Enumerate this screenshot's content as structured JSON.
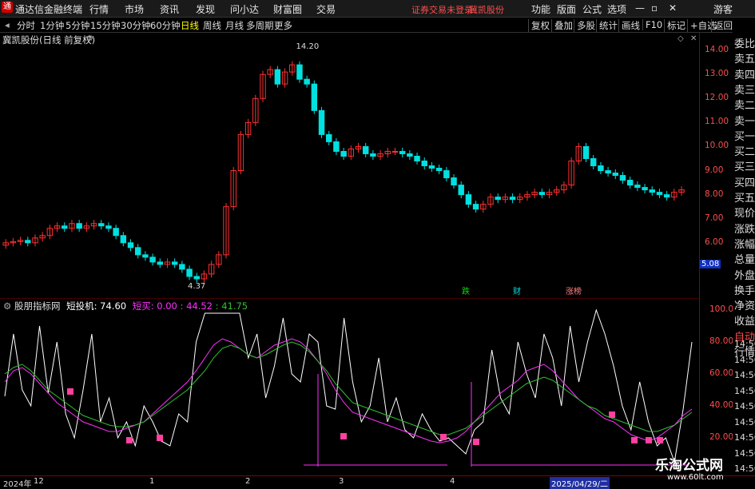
{
  "menu": {
    "app_name": "通达信金融终端",
    "items": [
      "行情",
      "市场",
      "资讯",
      "发现",
      "问小达",
      "财富圈",
      "交易"
    ],
    "notice": "证券交易未登录",
    "stock_link": "冀凯股份",
    "right_items": [
      "功能",
      "版面",
      "公式",
      "选项"
    ],
    "guest": "游客"
  },
  "toolbar": {
    "periods": [
      "分时",
      "1分钟",
      "5分钟",
      "15分钟",
      "30分钟",
      "60分钟",
      "日线",
      "周线",
      "月线",
      "多周期",
      "更多"
    ],
    "active_period": "日线",
    "buttons": [
      "复权",
      "叠加",
      "多股",
      "统计",
      "画线",
      "F10",
      "标记",
      "+自选",
      "返回"
    ]
  },
  "chart_title": "冀凯股份(日线 前复权)",
  "price_labels": {
    "high": "14.20",
    "low": "4.37",
    "current": "5.08"
  },
  "event_tags": [
    "跌",
    "财",
    "涨榜"
  ],
  "indicator": {
    "name": "股朋指标网",
    "line1_label": "短投机: 74.60",
    "line2_label": "短买: 0.00",
    "v1": "44.52",
    "v2": "41.75"
  },
  "right_panel": [
    "委比",
    "卖五",
    "卖四",
    "卖三",
    "卖二",
    "卖一",
    "买一",
    "买二",
    "买三",
    "买四",
    "买五",
    "现价",
    "涨跌",
    "涨幅",
    "总量",
    "外盘",
    "换手",
    "净资",
    "收益",
    "自动",
    "行情"
  ],
  "time_col": [
    "14:56",
    "14:56",
    "14:56",
    "14:56",
    "14:56",
    "14:56",
    "14:56",
    "14:56",
    "14:56"
  ],
  "dates": {
    "year": "2024年",
    "m12": "12",
    "m1": "1",
    "m2": "2",
    "m3": "3",
    "m4": "4",
    "cursor": "2025/04/29/二"
  },
  "watermark": {
    "cn": "乐淘公式网",
    "url": "www.60lt.com"
  },
  "colors": {
    "up": "#ff3030",
    "down": "#00e0e0",
    "white": "#ffffff",
    "purple": "#ff30ff",
    "green": "#30c030",
    "axis": "#8b0000"
  },
  "chart_data": {
    "type": "candlestick",
    "y_ticks": [
      6.0,
      7.0,
      8.0,
      9.0,
      10.0,
      11.0,
      12.0,
      13.0,
      14.0
    ],
    "indicator_ticks": [
      20.0,
      40.0,
      60.0,
      80.0,
      100.0
    ],
    "ylim": [
      4.2,
      14.5
    ],
    "closes": [
      6.0,
      6.05,
      6.1,
      6.0,
      6.2,
      6.3,
      6.6,
      6.7,
      6.6,
      6.8,
      6.6,
      6.7,
      6.8,
      6.7,
      6.6,
      6.3,
      6.0,
      5.8,
      5.5,
      5.4,
      5.2,
      5.1,
      5.2,
      5.1,
      4.9,
      4.6,
      4.5,
      4.7,
      5.1,
      5.5,
      7.5,
      9.0,
      10.5,
      11.0,
      12.0,
      13.0,
      13.2,
      12.6,
      13.1,
      13.4,
      12.8,
      12.6,
      11.5,
      10.5,
      10.2,
      9.8,
      9.6,
      9.9,
      10.0,
      9.7,
      9.6,
      9.7,
      9.8,
      9.8,
      9.7,
      9.6,
      9.4,
      9.2,
      9.1,
      9.0,
      8.7,
      8.4,
      8.0,
      7.6,
      7.4,
      7.6,
      7.9,
      7.8,
      7.9,
      7.8,
      7.9,
      8.0,
      8.1,
      8.0,
      8.1,
      8.2,
      8.4,
      9.4,
      10.0,
      9.5,
      9.2,
      9.0,
      8.9,
      8.8,
      8.6,
      8.4,
      8.3,
      8.2,
      8.1,
      8.0,
      7.9,
      8.1,
      8.2
    ],
    "indicator_white": [
      46,
      85,
      50,
      40,
      90,
      48,
      80,
      35,
      20,
      50,
      85,
      30,
      45,
      20,
      30,
      15,
      40,
      30,
      18,
      15,
      35,
      30,
      80,
      98,
      98,
      98,
      98,
      98,
      70,
      85,
      45,
      65,
      95,
      60,
      55,
      85,
      80,
      40,
      38,
      95,
      55,
      30,
      40,
      70,
      30,
      45,
      25,
      20,
      35,
      25,
      18,
      20,
      15,
      10,
      25,
      30,
      75,
      45,
      35,
      80,
      60,
      45,
      85,
      70,
      40,
      90,
      55,
      80,
      100,
      85,
      65,
      40,
      25,
      55,
      30,
      15,
      20,
      5,
      38,
      80
    ],
    "indicator_purple": [
      55,
      62,
      64,
      60,
      54,
      48,
      42,
      38,
      34,
      30,
      28,
      26,
      24,
      24,
      26,
      28,
      30,
      35,
      40,
      45,
      50,
      55,
      62,
      70,
      78,
      82,
      80,
      76,
      72,
      70,
      74,
      78,
      80,
      82,
      80,
      75,
      68,
      60,
      50,
      42,
      36,
      34,
      32,
      30,
      28,
      26,
      24,
      22,
      20,
      18,
      17,
      18,
      20,
      24,
      30,
      36,
      42,
      48,
      52,
      56,
      62,
      64,
      66,
      62,
      56,
      50,
      44,
      40,
      36,
      32,
      30,
      26,
      22,
      20,
      18,
      20,
      24,
      28,
      34,
      38
    ],
    "indicator_green": [
      60,
      64,
      66,
      62,
      56,
      50,
      46,
      42,
      38,
      34,
      32,
      30,
      28,
      27,
      27,
      28,
      30,
      34,
      38,
      42,
      46,
      50,
      56,
      62,
      70,
      76,
      78,
      76,
      72,
      70,
      72,
      75,
      78,
      80,
      78,
      74,
      68,
      62,
      54,
      48,
      42,
      40,
      38,
      36,
      34,
      32,
      30,
      28,
      26,
      24,
      22,
      22,
      24,
      26,
      30,
      34,
      38,
      42,
      46,
      50,
      54,
      56,
      58,
      56,
      52,
      48,
      44,
      40,
      38,
      34,
      32,
      30,
      28,
      26,
      24,
      24,
      26,
      28,
      32,
      36
    ]
  }
}
